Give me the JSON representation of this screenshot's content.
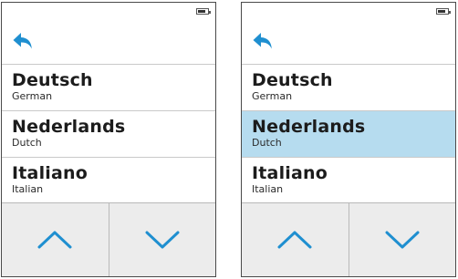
{
  "colors": {
    "accent": "#1f8fd0",
    "selected_row": "#b6dcef",
    "nav_background": "#ececec"
  },
  "icons": {
    "back": "back-arrow-icon",
    "up": "chevron-up-icon",
    "down": "chevron-down-icon",
    "battery": "battery-icon"
  },
  "screens": [
    {
      "items": [
        {
          "native": "Deutsch",
          "english": "German",
          "selected": false
        },
        {
          "native": "Nederlands",
          "english": "Dutch",
          "selected": false
        },
        {
          "native": "Italiano",
          "english": "Italian",
          "selected": false
        }
      ]
    },
    {
      "items": [
        {
          "native": "Deutsch",
          "english": "German",
          "selected": false
        },
        {
          "native": "Nederlands",
          "english": "Dutch",
          "selected": true
        },
        {
          "native": "Italiano",
          "english": "Italian",
          "selected": false
        }
      ]
    }
  ]
}
